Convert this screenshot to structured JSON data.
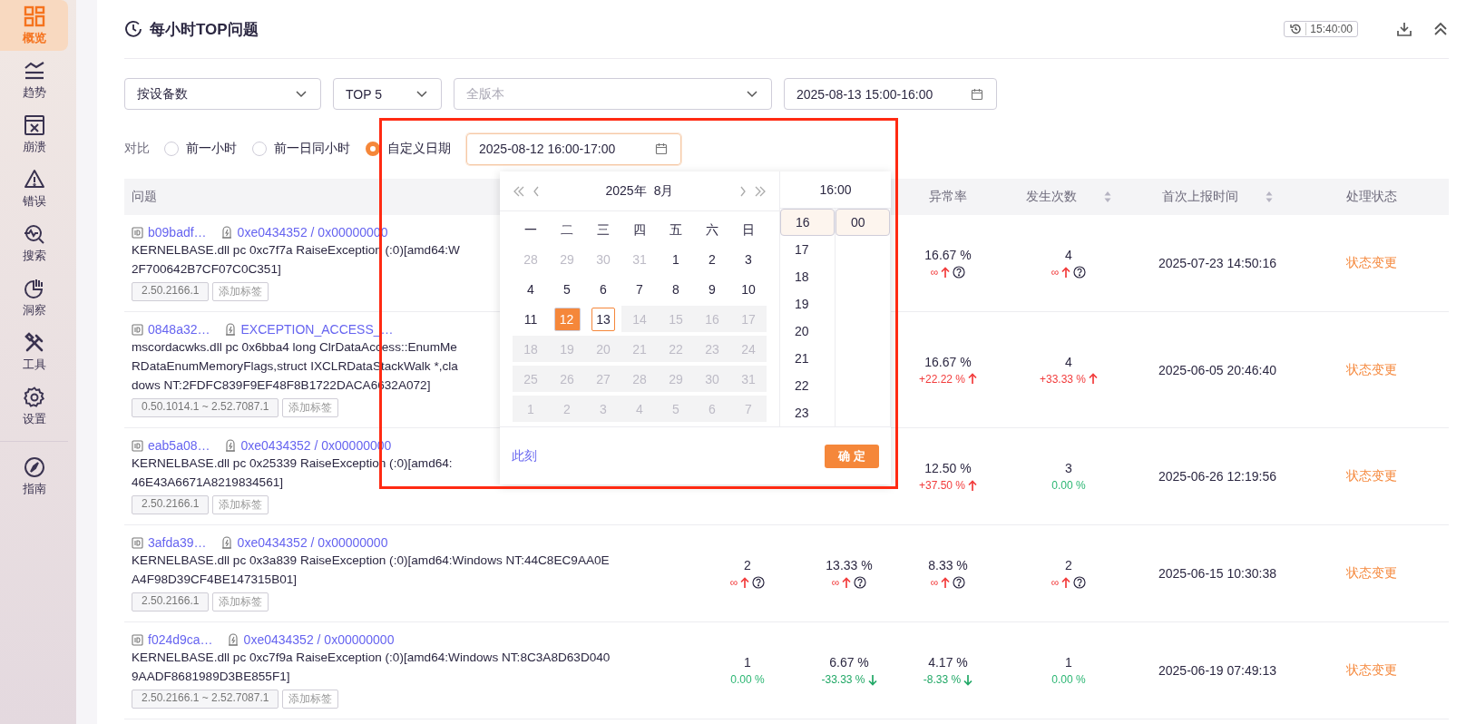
{
  "sidebar": {
    "items": [
      {
        "label": "概览",
        "selected": true
      },
      {
        "label": "趋势",
        "selected": false
      },
      {
        "label": "崩溃",
        "selected": false
      },
      {
        "label": "错误",
        "selected": false
      },
      {
        "label": "搜索",
        "selected": false
      },
      {
        "label": "洞察",
        "selected": false
      },
      {
        "label": "工具",
        "selected": false
      },
      {
        "label": "设置",
        "selected": false
      }
    ],
    "footer_items": [
      {
        "label": "指南",
        "selected": false
      }
    ]
  },
  "header": {
    "title": "每小时TOP问题",
    "time_badge": "15:40:00"
  },
  "filters": {
    "metric": {
      "value": "按设备数"
    },
    "top": {
      "value": "TOP 5"
    },
    "version": {
      "placeholder": "全版本"
    },
    "date_range": {
      "value": "2025-08-13 15:00-16:00"
    }
  },
  "compare": {
    "label": "对比",
    "options": [
      {
        "label": "前一小时",
        "selected": false
      },
      {
        "label": "前一日同小时",
        "selected": false
      },
      {
        "label": "自定义日期",
        "selected": true
      }
    ],
    "custom_date": {
      "value": "2025-08-12 16:00-17:00"
    }
  },
  "date_picker": {
    "year": "2025年",
    "month": "8月",
    "weekdays": [
      "一",
      "二",
      "三",
      "四",
      "五",
      "六",
      "日"
    ],
    "weeks": [
      [
        {
          "day": "28",
          "kind": "out",
          "selected": false
        },
        {
          "day": "29",
          "kind": "out",
          "selected": false
        },
        {
          "day": "30",
          "kind": "out",
          "selected": false
        },
        {
          "day": "31",
          "kind": "out",
          "selected": false
        },
        {
          "day": "1",
          "kind": "normal",
          "selected": false
        },
        {
          "day": "2",
          "kind": "normal",
          "selected": false
        },
        {
          "day": "3",
          "kind": "normal",
          "selected": false
        }
      ],
      [
        {
          "day": "4",
          "kind": "normal",
          "selected": false
        },
        {
          "day": "5",
          "kind": "normal",
          "selected": false
        },
        {
          "day": "6",
          "kind": "normal",
          "selected": false
        },
        {
          "day": "7",
          "kind": "normal",
          "selected": false
        },
        {
          "day": "8",
          "kind": "normal",
          "selected": false
        },
        {
          "day": "9",
          "kind": "normal",
          "selected": false
        },
        {
          "day": "10",
          "kind": "normal",
          "selected": false
        }
      ],
      [
        {
          "day": "11",
          "kind": "normal",
          "selected": false
        },
        {
          "day": "12",
          "kind": "normal",
          "selected": true
        },
        {
          "day": "13",
          "kind": "today",
          "selected": false
        },
        {
          "day": "14",
          "kind": "disabled",
          "selected": false
        },
        {
          "day": "15",
          "kind": "disabled",
          "selected": false
        },
        {
          "day": "16",
          "kind": "disabled",
          "selected": false
        },
        {
          "day": "17",
          "kind": "disabled",
          "selected": false
        }
      ],
      [
        {
          "day": "18",
          "kind": "disabled",
          "selected": false
        },
        {
          "day": "19",
          "kind": "disabled",
          "selected": false
        },
        {
          "day": "20",
          "kind": "disabled",
          "selected": false
        },
        {
          "day": "21",
          "kind": "disabled",
          "selected": false
        },
        {
          "day": "22",
          "kind": "disabled",
          "selected": false
        },
        {
          "day": "23",
          "kind": "disabled",
          "selected": false
        },
        {
          "day": "24",
          "kind": "disabled",
          "selected": false
        }
      ],
      [
        {
          "day": "25",
          "kind": "disabled",
          "selected": false
        },
        {
          "day": "26",
          "kind": "disabled",
          "selected": false
        },
        {
          "day": "27",
          "kind": "disabled",
          "selected": false
        },
        {
          "day": "28",
          "kind": "disabled",
          "selected": false
        },
        {
          "day": "29",
          "kind": "disabled",
          "selected": false
        },
        {
          "day": "30",
          "kind": "disabled",
          "selected": false
        },
        {
          "day": "31",
          "kind": "disabled",
          "selected": false
        }
      ],
      [
        {
          "day": "1",
          "kind": "disabled",
          "selected": false
        },
        {
          "day": "2",
          "kind": "disabled",
          "selected": false
        },
        {
          "day": "3",
          "kind": "disabled",
          "selected": false
        },
        {
          "day": "4",
          "kind": "disabled",
          "selected": false
        },
        {
          "day": "5",
          "kind": "disabled",
          "selected": false
        },
        {
          "day": "6",
          "kind": "disabled",
          "selected": false
        },
        {
          "day": "7",
          "kind": "disabled",
          "selected": false
        }
      ]
    ],
    "time_header": "16:00",
    "hours": [
      {
        "label": "16",
        "selected": true
      },
      {
        "label": "17",
        "selected": false
      },
      {
        "label": "18",
        "selected": false
      },
      {
        "label": "19",
        "selected": false
      },
      {
        "label": "20",
        "selected": false
      },
      {
        "label": "21",
        "selected": false
      },
      {
        "label": "22",
        "selected": false
      },
      {
        "label": "23",
        "selected": false
      }
    ],
    "minutes": [
      {
        "label": "00",
        "selected": true
      }
    ],
    "now_link": "此刻",
    "confirm_button": "确 定"
  },
  "table": {
    "columns": [
      {
        "label": "问题"
      },
      {},
      {},
      {
        "label": "异常率"
      },
      {
        "label": "发生次数",
        "sortable": true
      },
      {
        "label": "首次上报时间",
        "sortable": true
      },
      {
        "label": "处理状态"
      }
    ],
    "rows": [
      {
        "id": "b09badf…",
        "signature": "0xe0434352 / 0x00000000",
        "desc_lines": [
          "KERNELBASE.dll pc 0xc7f7a RaiseException (:0)[amd64:W",
          "2F700642B7CF07C0C351]"
        ],
        "version": "2.50.2166.1",
        "tag_button": "添加标签",
        "anomaly_rate": {
          "value": "16.67 %",
          "change": "∞",
          "up": true,
          "down": false,
          "help": true
        },
        "count": {
          "value": "4",
          "change": "∞",
          "up": true,
          "down": false,
          "help": true
        },
        "first_time": "2025-07-23 14:50:16",
        "status": "状态变更"
      },
      {
        "id": "0848a32…",
        "signature": "EXCEPTION_ACCESS_…",
        "desc_lines": [
          "mscordacwks.dll pc 0x6bba4 long ClrDataAccess::EnumMe",
          "RDataEnumMemoryFlags,struct IXCLRDataStackWalk *,cla",
          "dows NT:2FDFC839F9EF48F8B1722DACA6632A072]"
        ],
        "version": "0.50.1014.1 ~ 2.52.7087.1",
        "tag_button": "添加标签",
        "anomaly_rate": {
          "value": "16.67 %",
          "change": "+22.22 %",
          "up": true,
          "down": false
        },
        "count": {
          "value": "4",
          "change": "+33.33 %",
          "up": true,
          "down": false
        },
        "first_time": "2025-06-05 20:46:40",
        "status": "状态变更"
      },
      {
        "id": "eab5a08…",
        "signature": "0xe0434352 / 0x00000000",
        "desc_lines": [
          "KERNELBASE.dll pc 0x25339 RaiseException (:0)[amd64:",
          "46E43A6671A8219834561]"
        ],
        "version": "2.50.2166.1",
        "tag_button": "添加标签",
        "anomaly_rate": {
          "value": "12.50 %",
          "change": "+37.50 %",
          "up": true,
          "down": false
        },
        "count": {
          "value": "3",
          "change": "0.00 %",
          "up": false,
          "down": false
        },
        "first_time": "2025-06-26 12:19:56",
        "status": "状态变更"
      },
      {
        "id": "3afda39…",
        "signature": "0xe0434352 / 0x00000000",
        "desc_lines": [
          "KERNELBASE.dll pc 0x3a839 RaiseException (:0)[amd64:Windows NT:44C8EC9AA0E",
          "A4F98D39CF4BE147315B01]"
        ],
        "version": "2.50.2166.1",
        "tag_button": "添加标签",
        "column_2": {
          "value": "2",
          "change": "∞",
          "up": true,
          "down": false,
          "help": true
        },
        "column_3": {
          "value": "13.33 %",
          "change": "∞",
          "up": true,
          "down": false,
          "help": true
        },
        "anomaly_rate": {
          "value": "8.33 %",
          "change": "∞",
          "up": true,
          "down": false,
          "help": true
        },
        "count": {
          "value": "2",
          "change": "∞",
          "up": true,
          "down": false,
          "help": true
        },
        "first_time": "2025-06-15 10:30:38",
        "status": "状态变更"
      },
      {
        "id": "f024d9ca…",
        "signature": "0xe0434352 / 0x00000000",
        "desc_lines": [
          "KERNELBASE.dll pc 0xc7f9a RaiseException (:0)[amd64:Windows NT:8C3A8D63D040",
          "9AADF8681989D3BE855F1]"
        ],
        "version": "2.50.2166.1 ~ 2.52.7087.1",
        "tag_button": "添加标签",
        "column_2": {
          "value": "1",
          "change": "0.00 %",
          "up": false,
          "down": false
        },
        "column_3": {
          "value": "6.67 %",
          "change": "-33.33 %",
          "up": false,
          "down": true
        },
        "anomaly_rate": {
          "value": "4.17 %",
          "change": "-8.33 %",
          "up": false,
          "down": true
        },
        "count": {
          "value": "1",
          "change": "0.00 %",
          "up": false,
          "down": false
        },
        "first_time": "2025-06-19 07:49:13",
        "status": "状态变更"
      }
    ]
  },
  "annotation": {
    "highlight_box": true
  }
}
